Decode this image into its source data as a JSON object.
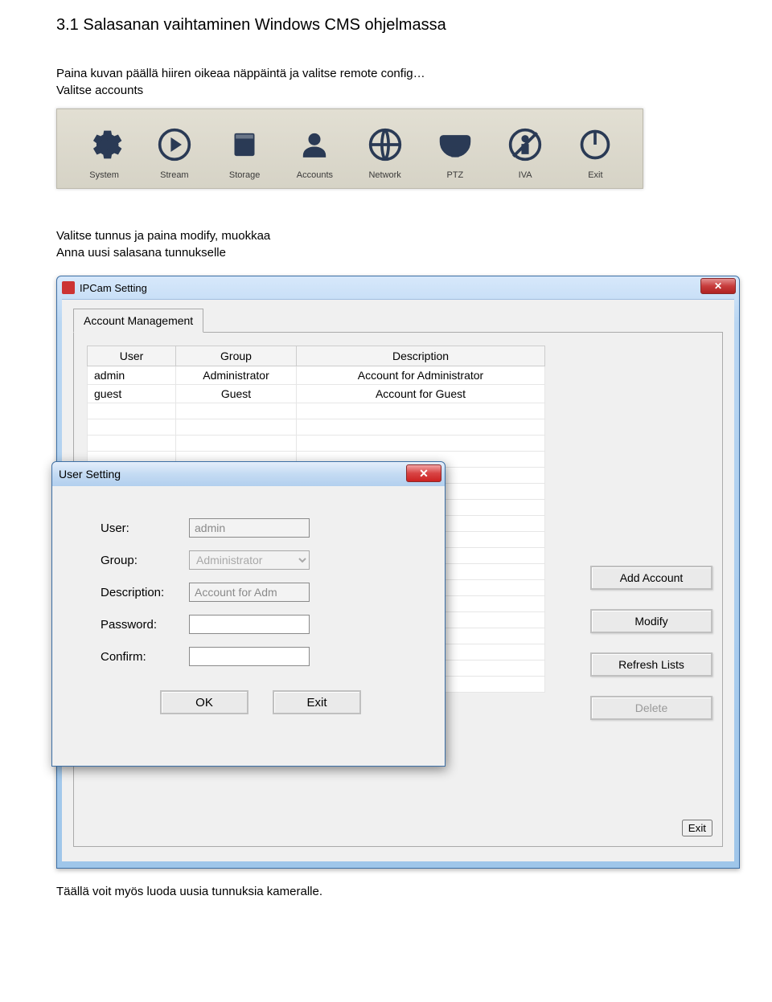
{
  "heading": "3.1 Salasanan vaihtaminen Windows CMS ohjelmassa",
  "intro": {
    "line1": "Paina kuvan päällä hiiren oikeaa näppäintä ja valitse remote config…",
    "line2": "Valitse accounts"
  },
  "toolbar": {
    "items": [
      {
        "name": "system",
        "label": "System"
      },
      {
        "name": "stream",
        "label": "Stream"
      },
      {
        "name": "storage",
        "label": "Storage"
      },
      {
        "name": "accounts",
        "label": "Accounts"
      },
      {
        "name": "network",
        "label": "Network"
      },
      {
        "name": "ptz",
        "label": "PTZ"
      },
      {
        "name": "iva",
        "label": "IVA"
      },
      {
        "name": "exit",
        "label": "Exit"
      }
    ]
  },
  "mid": {
    "line1": "Valitse tunnus ja paina modify, muokkaa",
    "line2": "Anna uusi salasana tunnukselle"
  },
  "settings_window": {
    "title": "IPCam Setting",
    "tab_label": "Account Management",
    "table": {
      "headers": {
        "user": "User",
        "group": "Group",
        "description": "Description"
      },
      "rows": [
        {
          "user": "admin",
          "group": "Administrator",
          "description": "Account for Administrator"
        },
        {
          "user": "guest",
          "group": "Guest",
          "description": "Account for Guest"
        }
      ]
    },
    "side_buttons": {
      "add": "Add Account",
      "modify": "Modify",
      "refresh": "Refresh Lists",
      "delete": "Delete",
      "exit": "Exit"
    }
  },
  "user_dialog": {
    "title": "User Setting",
    "labels": {
      "user": "User:",
      "group": "Group:",
      "description": "Description:",
      "password": "Password:",
      "confirm": "Confirm:"
    },
    "values": {
      "user": "admin",
      "group": "Administrator",
      "description": "Account for Adm"
    },
    "buttons": {
      "ok": "OK",
      "exit": "Exit"
    }
  },
  "footer": "Täällä voit myös luoda uusia tunnuksia kameralle."
}
